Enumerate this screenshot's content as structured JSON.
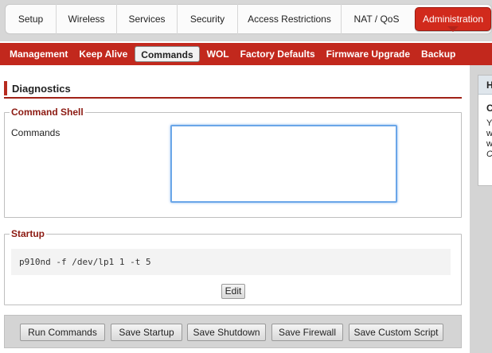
{
  "topnav": {
    "tabs": [
      {
        "label": "Setup"
      },
      {
        "label": "Wireless"
      },
      {
        "label": "Services"
      },
      {
        "label": "Security"
      },
      {
        "label": "Access Restrictions"
      },
      {
        "label": "NAT / QoS"
      }
    ],
    "active_tab": "Administration"
  },
  "subnav": {
    "items": [
      {
        "label": "Management"
      },
      {
        "label": "Keep Alive"
      },
      {
        "label": "Commands"
      },
      {
        "label": "WOL"
      },
      {
        "label": "Factory Defaults"
      },
      {
        "label": "Firmware Upgrade"
      },
      {
        "label": "Backup"
      }
    ],
    "active_index": 2
  },
  "page": {
    "title": "Diagnostics",
    "command_shell": {
      "legend": "Command Shell",
      "commands_label": "Commands",
      "commands_value": ""
    },
    "startup": {
      "legend": "Startup",
      "script": "p910nd -f /dev/lp1 1 -t 5",
      "edit_label": "Edit"
    },
    "buttons": {
      "run": "Run Commands",
      "save_startup": "Save Startup",
      "save_shutdown": "Save Shutdown",
      "save_firewall": "Save Firewall",
      "save_custom": "Save Custom Script"
    }
  },
  "help": {
    "title": "H",
    "heading": "C",
    "lines": [
      "Y",
      "w",
      "w",
      "C"
    ]
  },
  "colors": {
    "accent_red": "#c2281d",
    "legend_red": "#8c1a12",
    "focus_blue": "#6aa6e8"
  }
}
